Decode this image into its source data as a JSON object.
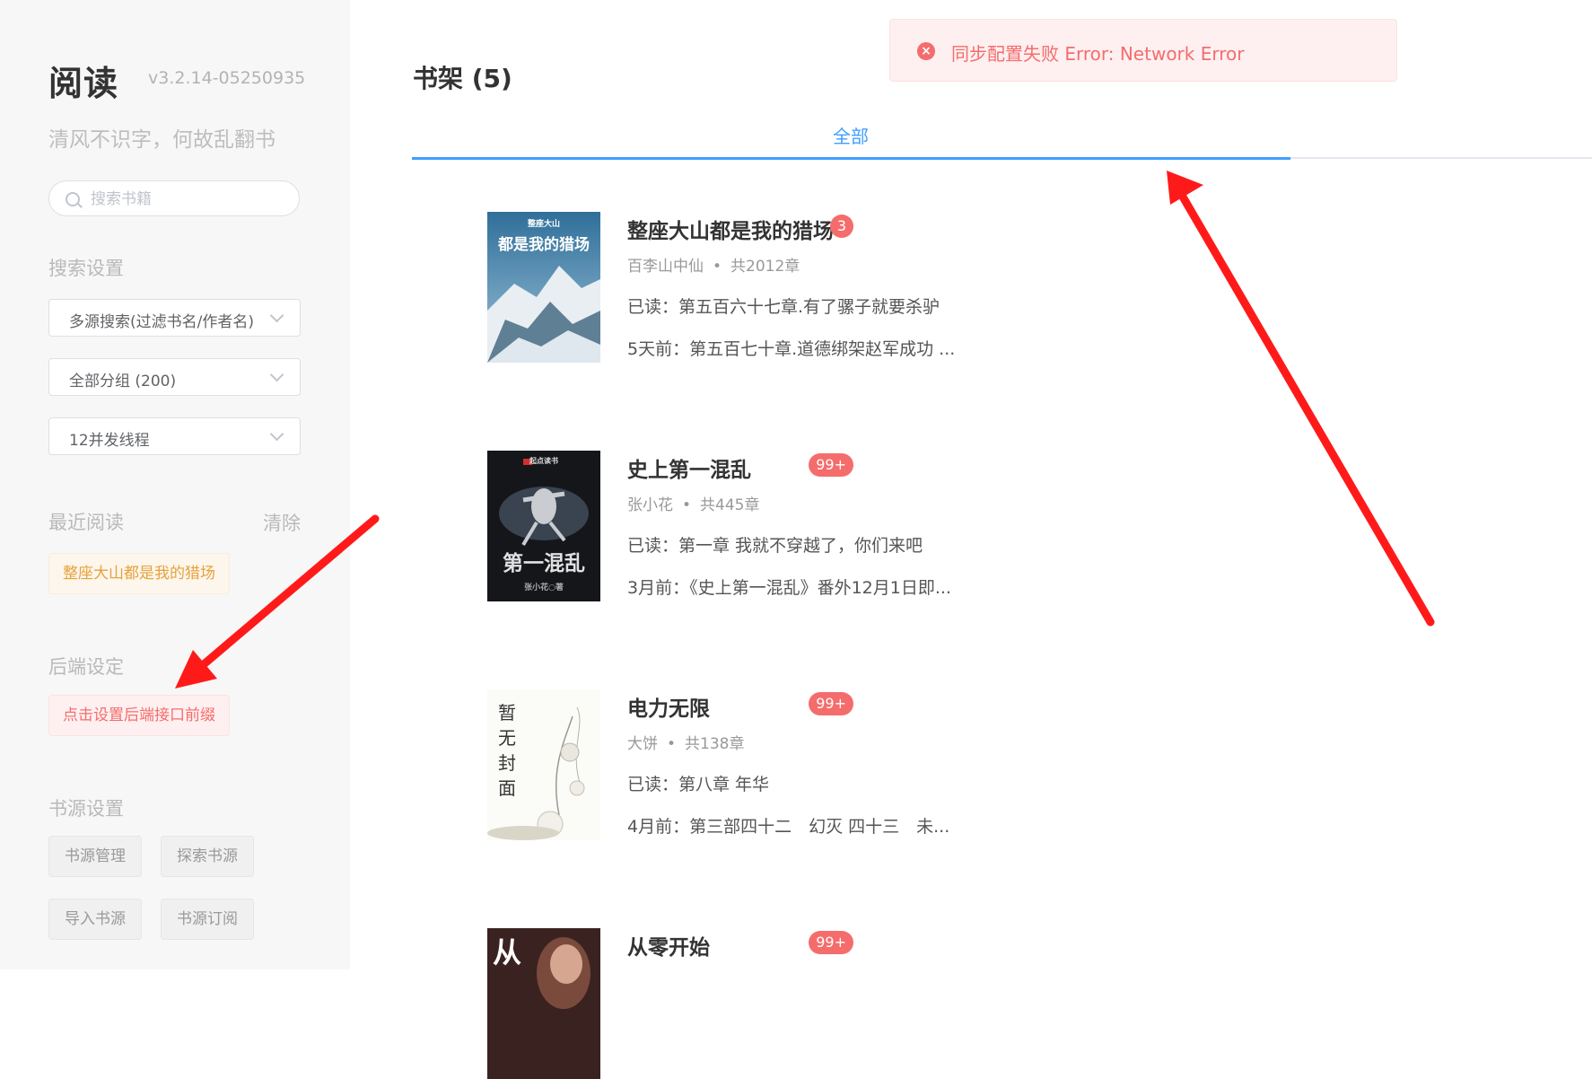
{
  "sidebar": {
    "app_title": "阅读",
    "version": "v3.2.14-05250935",
    "tagline": "清风不识字，何故乱翻书",
    "search": {
      "placeholder": "搜索书籍"
    },
    "search_settings": {
      "label": "搜索设置",
      "search_mode": "多源搜索(过滤书名/作者名)",
      "group": "全部分组 (200)",
      "threads": "12并发线程"
    },
    "recent": {
      "label": "最近阅读",
      "clear_label": "清除",
      "items": [
        "整座大山都是我的猎场"
      ]
    },
    "backend": {
      "label": "后端设定",
      "button_label": "点击设置后端接口前缀"
    },
    "source_settings": {
      "label": "书源设置",
      "buttons": [
        "书源管理",
        "探索书源",
        "导入书源",
        "书源订阅"
      ]
    }
  },
  "main": {
    "shelf_title": "书架 (5)",
    "tabs": [
      {
        "label": "全部",
        "active": true
      }
    ],
    "books": [
      {
        "title": "整座大山都是我的猎场",
        "badge": "3",
        "author": "百李山中仙",
        "chapters": "共2012章",
        "read": "已读：第五百六十七章.有了骡子就要杀驴",
        "latest": "5天前：第五百七十章.道德绑架赵军成功 ...",
        "cover_text": "都是我的猎场",
        "cover_small": "整座大山"
      },
      {
        "title": "史上第一混乱",
        "badge": "99+",
        "author": "张小花",
        "chapters": "共445章",
        "read": "已读：第一章 我就不穿越了，你们来吧",
        "latest": "3月前：《史上第一混乱》番外12月1日即...",
        "cover_text": "第一混乱",
        "cover_small": "起点读书",
        "cover_author": "张小花○著"
      },
      {
        "title": "电力无限",
        "badge": "99+",
        "author": "大饼",
        "chapters": "共138章",
        "read": "已读：第八章 年华",
        "latest": "4月前：第三部四十二　幻灭 四十三　未...",
        "cover_text": "暂无封面"
      },
      {
        "title": "从零开始",
        "badge": "99+",
        "cover_text": "从"
      }
    ]
  },
  "toast": {
    "message": "同步配置失败 Error: Network Error",
    "type": "error"
  },
  "colors": {
    "accent": "#409eff",
    "error": "#f56c6c",
    "warning": "#e6a23c",
    "annotation_arrow": "#ff1a1a"
  }
}
